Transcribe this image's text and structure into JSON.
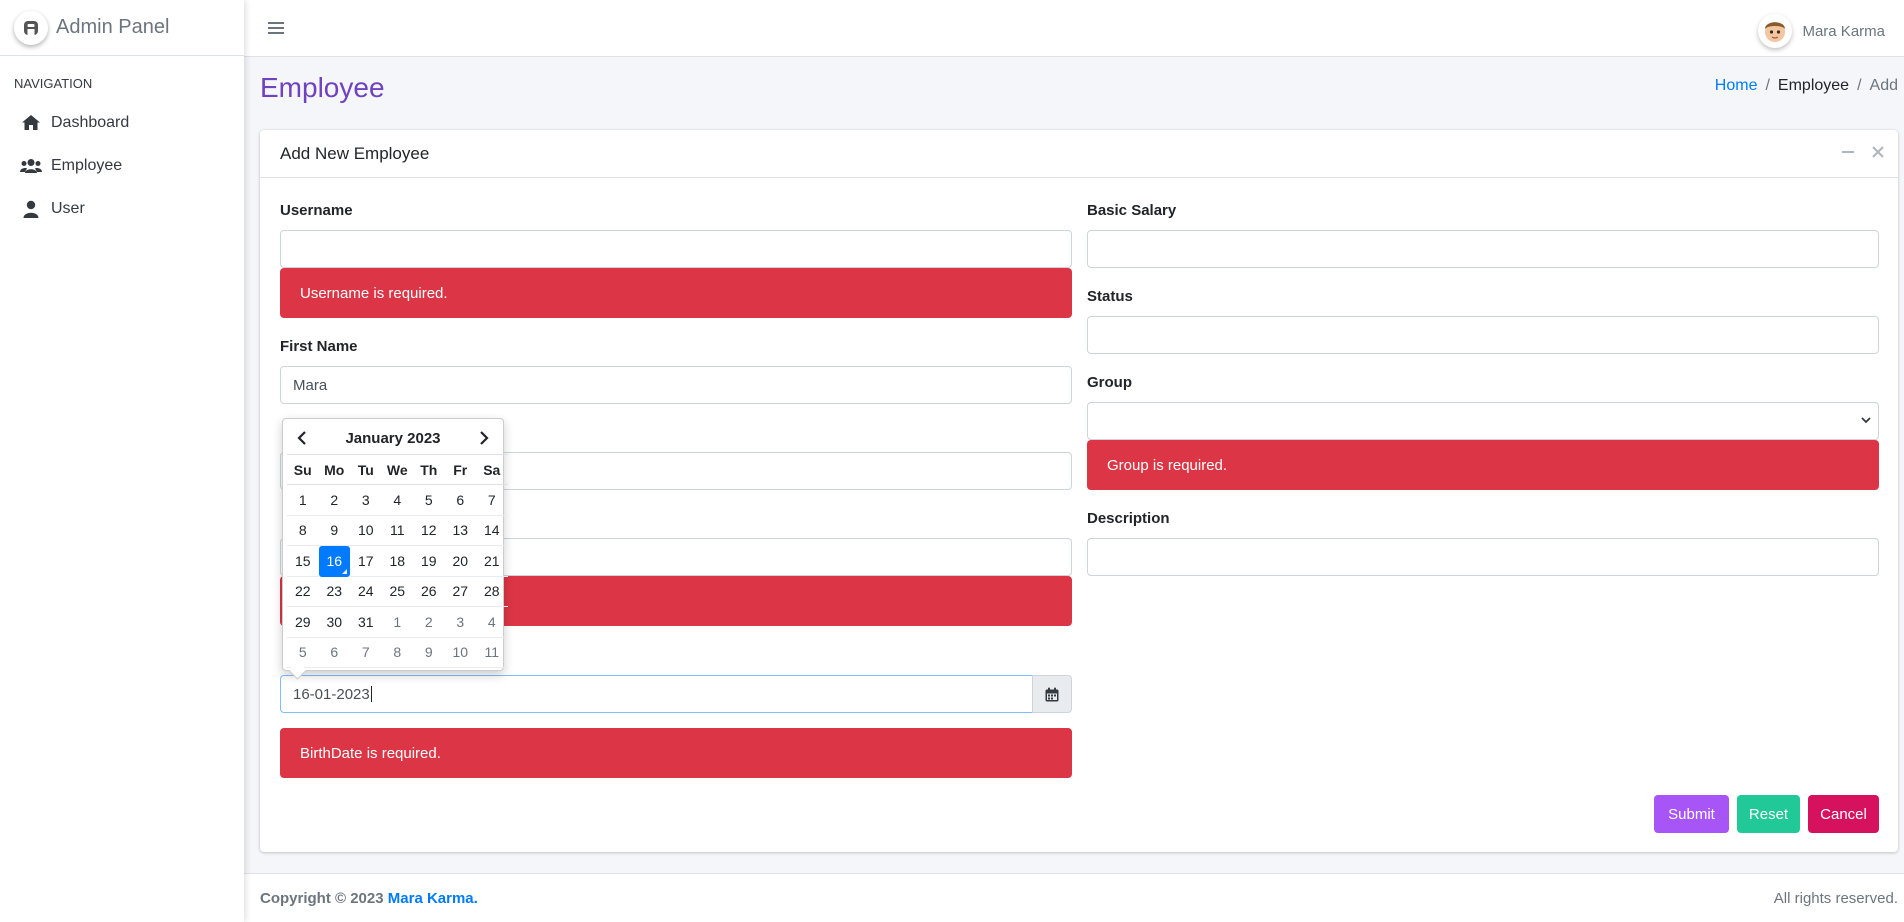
{
  "app": {
    "brand": "Admin Panel",
    "user_name": "Mara Karma"
  },
  "sidebar": {
    "header": "NAVIGATION",
    "items": [
      {
        "label": "Dashboard",
        "icon": "home-icon"
      },
      {
        "label": "Employee",
        "icon": "users-icon"
      },
      {
        "label": "User",
        "icon": "user-icon"
      }
    ]
  },
  "page": {
    "title": "Employee",
    "breadcrumb": [
      "Home",
      "/",
      "Employee",
      "/",
      "Add"
    ]
  },
  "card": {
    "title": "Add New Employee"
  },
  "form": {
    "username": {
      "label": "Username",
      "value": "",
      "error": "Username is required."
    },
    "first_name": {
      "label": "First Name",
      "value": "Mara"
    },
    "field3": {
      "value": ""
    },
    "field4": {
      "value": "",
      "error": ""
    },
    "birth_date": {
      "value": "16-01-2023",
      "error": "BirthDate is required."
    },
    "basic_salary": {
      "label": "Basic Salary",
      "value": ""
    },
    "status": {
      "label": "Status",
      "value": ""
    },
    "group": {
      "label": "Group",
      "value": "",
      "error": "Group is required."
    },
    "description": {
      "label": "Description",
      "value": ""
    }
  },
  "buttons": {
    "submit": "Submit",
    "reset": "Reset",
    "cancel": "Cancel"
  },
  "datepicker": {
    "month_label": "January 2023",
    "weekdays": [
      "Su",
      "Mo",
      "Tu",
      "We",
      "Th",
      "Fr",
      "Sa"
    ],
    "days": [
      {
        "d": "1",
        "m": false
      },
      {
        "d": "2",
        "m": false
      },
      {
        "d": "3",
        "m": false
      },
      {
        "d": "4",
        "m": false
      },
      {
        "d": "5",
        "m": false
      },
      {
        "d": "6",
        "m": false
      },
      {
        "d": "7",
        "m": false
      },
      {
        "d": "8",
        "m": false
      },
      {
        "d": "9",
        "m": false
      },
      {
        "d": "10",
        "m": false
      },
      {
        "d": "11",
        "m": false
      },
      {
        "d": "12",
        "m": false
      },
      {
        "d": "13",
        "m": false
      },
      {
        "d": "14",
        "m": false
      },
      {
        "d": "15",
        "m": false
      },
      {
        "d": "16",
        "m": false,
        "active": true
      },
      {
        "d": "17",
        "m": false
      },
      {
        "d": "18",
        "m": false
      },
      {
        "d": "19",
        "m": false
      },
      {
        "d": "20",
        "m": false
      },
      {
        "d": "21",
        "m": false
      },
      {
        "d": "22",
        "m": false
      },
      {
        "d": "23",
        "m": false
      },
      {
        "d": "24",
        "m": false
      },
      {
        "d": "25",
        "m": false
      },
      {
        "d": "26",
        "m": false
      },
      {
        "d": "27",
        "m": false
      },
      {
        "d": "28",
        "m": false
      },
      {
        "d": "29",
        "m": false
      },
      {
        "d": "30",
        "m": false
      },
      {
        "d": "31",
        "m": false
      },
      {
        "d": "1",
        "m": true
      },
      {
        "d": "2",
        "m": true
      },
      {
        "d": "3",
        "m": true
      },
      {
        "d": "4",
        "m": true
      },
      {
        "d": "5",
        "m": true
      },
      {
        "d": "6",
        "m": true
      },
      {
        "d": "7",
        "m": true
      },
      {
        "d": "8",
        "m": true
      },
      {
        "d": "9",
        "m": true
      },
      {
        "d": "10",
        "m": true
      },
      {
        "d": "11",
        "m": true
      }
    ]
  },
  "footer": {
    "copyright": "Copyright © 2023",
    "brand": "Mara Karma.",
    "rights": "All rights reserved."
  },
  "colors": {
    "accent": "#6f42c1",
    "link": "#007bff",
    "danger": "#dc3545",
    "submit": "#a855f7",
    "reset": "#20c997",
    "cancel": "#d6125e"
  }
}
